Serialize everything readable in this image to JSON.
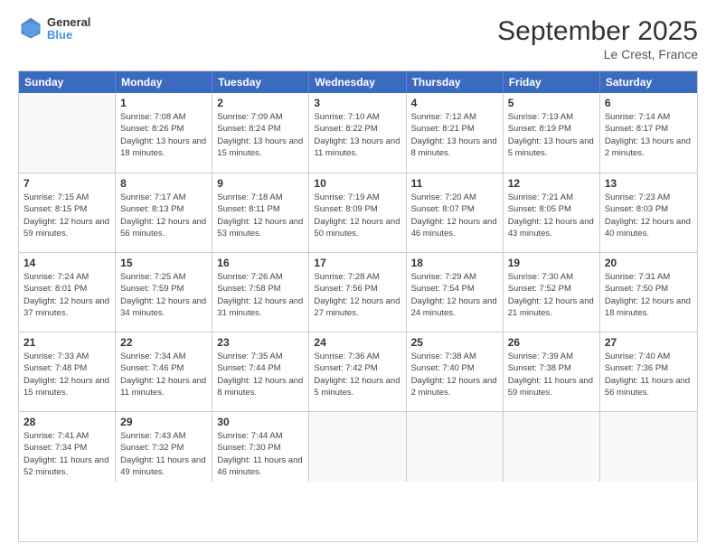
{
  "logo": {
    "line1": "General",
    "line2": "Blue"
  },
  "title": "September 2025",
  "subtitle": "Le Crest, France",
  "header_days": [
    "Sunday",
    "Monday",
    "Tuesday",
    "Wednesday",
    "Thursday",
    "Friday",
    "Saturday"
  ],
  "weeks": [
    [
      {
        "day": "",
        "sunrise": "",
        "sunset": "",
        "daylight": ""
      },
      {
        "day": "1",
        "sunrise": "Sunrise: 7:08 AM",
        "sunset": "Sunset: 8:26 PM",
        "daylight": "Daylight: 13 hours and 18 minutes."
      },
      {
        "day": "2",
        "sunrise": "Sunrise: 7:09 AM",
        "sunset": "Sunset: 8:24 PM",
        "daylight": "Daylight: 13 hours and 15 minutes."
      },
      {
        "day": "3",
        "sunrise": "Sunrise: 7:10 AM",
        "sunset": "Sunset: 8:22 PM",
        "daylight": "Daylight: 13 hours and 11 minutes."
      },
      {
        "day": "4",
        "sunrise": "Sunrise: 7:12 AM",
        "sunset": "Sunset: 8:21 PM",
        "daylight": "Daylight: 13 hours and 8 minutes."
      },
      {
        "day": "5",
        "sunrise": "Sunrise: 7:13 AM",
        "sunset": "Sunset: 8:19 PM",
        "daylight": "Daylight: 13 hours and 5 minutes."
      },
      {
        "day": "6",
        "sunrise": "Sunrise: 7:14 AM",
        "sunset": "Sunset: 8:17 PM",
        "daylight": "Daylight: 13 hours and 2 minutes."
      }
    ],
    [
      {
        "day": "7",
        "sunrise": "Sunrise: 7:15 AM",
        "sunset": "Sunset: 8:15 PM",
        "daylight": "Daylight: 12 hours and 59 minutes."
      },
      {
        "day": "8",
        "sunrise": "Sunrise: 7:17 AM",
        "sunset": "Sunset: 8:13 PM",
        "daylight": "Daylight: 12 hours and 56 minutes."
      },
      {
        "day": "9",
        "sunrise": "Sunrise: 7:18 AM",
        "sunset": "Sunset: 8:11 PM",
        "daylight": "Daylight: 12 hours and 53 minutes."
      },
      {
        "day": "10",
        "sunrise": "Sunrise: 7:19 AM",
        "sunset": "Sunset: 8:09 PM",
        "daylight": "Daylight: 12 hours and 50 minutes."
      },
      {
        "day": "11",
        "sunrise": "Sunrise: 7:20 AM",
        "sunset": "Sunset: 8:07 PM",
        "daylight": "Daylight: 12 hours and 46 minutes."
      },
      {
        "day": "12",
        "sunrise": "Sunrise: 7:21 AM",
        "sunset": "Sunset: 8:05 PM",
        "daylight": "Daylight: 12 hours and 43 minutes."
      },
      {
        "day": "13",
        "sunrise": "Sunrise: 7:23 AM",
        "sunset": "Sunset: 8:03 PM",
        "daylight": "Daylight: 12 hours and 40 minutes."
      }
    ],
    [
      {
        "day": "14",
        "sunrise": "Sunrise: 7:24 AM",
        "sunset": "Sunset: 8:01 PM",
        "daylight": "Daylight: 12 hours and 37 minutes."
      },
      {
        "day": "15",
        "sunrise": "Sunrise: 7:25 AM",
        "sunset": "Sunset: 7:59 PM",
        "daylight": "Daylight: 12 hours and 34 minutes."
      },
      {
        "day": "16",
        "sunrise": "Sunrise: 7:26 AM",
        "sunset": "Sunset: 7:58 PM",
        "daylight": "Daylight: 12 hours and 31 minutes."
      },
      {
        "day": "17",
        "sunrise": "Sunrise: 7:28 AM",
        "sunset": "Sunset: 7:56 PM",
        "daylight": "Daylight: 12 hours and 27 minutes."
      },
      {
        "day": "18",
        "sunrise": "Sunrise: 7:29 AM",
        "sunset": "Sunset: 7:54 PM",
        "daylight": "Daylight: 12 hours and 24 minutes."
      },
      {
        "day": "19",
        "sunrise": "Sunrise: 7:30 AM",
        "sunset": "Sunset: 7:52 PM",
        "daylight": "Daylight: 12 hours and 21 minutes."
      },
      {
        "day": "20",
        "sunrise": "Sunrise: 7:31 AM",
        "sunset": "Sunset: 7:50 PM",
        "daylight": "Daylight: 12 hours and 18 minutes."
      }
    ],
    [
      {
        "day": "21",
        "sunrise": "Sunrise: 7:33 AM",
        "sunset": "Sunset: 7:48 PM",
        "daylight": "Daylight: 12 hours and 15 minutes."
      },
      {
        "day": "22",
        "sunrise": "Sunrise: 7:34 AM",
        "sunset": "Sunset: 7:46 PM",
        "daylight": "Daylight: 12 hours and 11 minutes."
      },
      {
        "day": "23",
        "sunrise": "Sunrise: 7:35 AM",
        "sunset": "Sunset: 7:44 PM",
        "daylight": "Daylight: 12 hours and 8 minutes."
      },
      {
        "day": "24",
        "sunrise": "Sunrise: 7:36 AM",
        "sunset": "Sunset: 7:42 PM",
        "daylight": "Daylight: 12 hours and 5 minutes."
      },
      {
        "day": "25",
        "sunrise": "Sunrise: 7:38 AM",
        "sunset": "Sunset: 7:40 PM",
        "daylight": "Daylight: 12 hours and 2 minutes."
      },
      {
        "day": "26",
        "sunrise": "Sunrise: 7:39 AM",
        "sunset": "Sunset: 7:38 PM",
        "daylight": "Daylight: 11 hours and 59 minutes."
      },
      {
        "day": "27",
        "sunrise": "Sunrise: 7:40 AM",
        "sunset": "Sunset: 7:36 PM",
        "daylight": "Daylight: 11 hours and 56 minutes."
      }
    ],
    [
      {
        "day": "28",
        "sunrise": "Sunrise: 7:41 AM",
        "sunset": "Sunset: 7:34 PM",
        "daylight": "Daylight: 11 hours and 52 minutes."
      },
      {
        "day": "29",
        "sunrise": "Sunrise: 7:43 AM",
        "sunset": "Sunset: 7:32 PM",
        "daylight": "Daylight: 11 hours and 49 minutes."
      },
      {
        "day": "30",
        "sunrise": "Sunrise: 7:44 AM",
        "sunset": "Sunset: 7:30 PM",
        "daylight": "Daylight: 11 hours and 46 minutes."
      },
      {
        "day": "",
        "sunrise": "",
        "sunset": "",
        "daylight": ""
      },
      {
        "day": "",
        "sunrise": "",
        "sunset": "",
        "daylight": ""
      },
      {
        "day": "",
        "sunrise": "",
        "sunset": "",
        "daylight": ""
      },
      {
        "day": "",
        "sunrise": "",
        "sunset": "",
        "daylight": ""
      }
    ]
  ]
}
